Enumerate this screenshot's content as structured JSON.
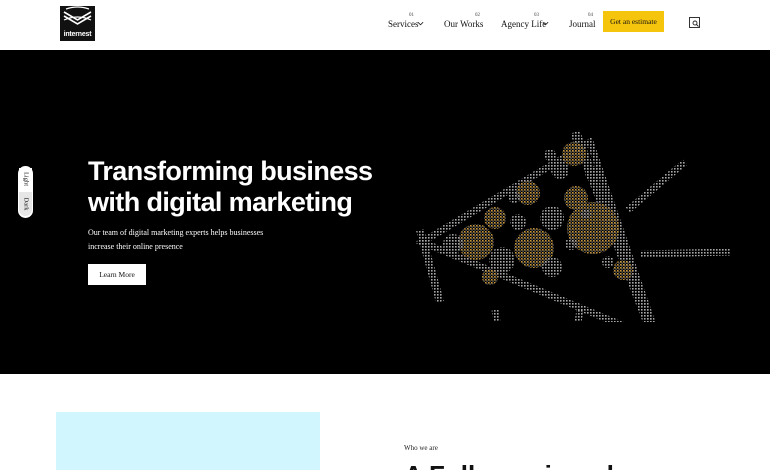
{
  "brand": {
    "name": "internest",
    "logo_icon": "internest-logo"
  },
  "nav": {
    "items": [
      {
        "number": "01",
        "label": "Services",
        "has_dropdown": true
      },
      {
        "number": "02",
        "label": "Our Works",
        "has_dropdown": false
      },
      {
        "number": "03",
        "label": "Agency Life",
        "has_dropdown": true
      },
      {
        "number": "04",
        "label": "Journal",
        "has_dropdown": false
      }
    ],
    "cta_label": "Get an estimate",
    "search_icon": "search-icon"
  },
  "theme_toggle": {
    "light_label": "Light",
    "dark_label": "Dark"
  },
  "hero": {
    "title": "Transforming business with digital marketing",
    "description": "Our team of digital marketing experts helps businesses increase their online presence",
    "button_label": "Learn More",
    "illustration": "megaphone-illustration"
  },
  "about": {
    "eyebrow": "Who we are",
    "heading": "A Fully-equipped"
  },
  "colors": {
    "accent": "#f5c40c",
    "hero_bg": "#000000",
    "illustration_gold": "#c8963a",
    "illustration_grey": "#9a9a9a",
    "about_image_bg": "#d2f6fd"
  }
}
